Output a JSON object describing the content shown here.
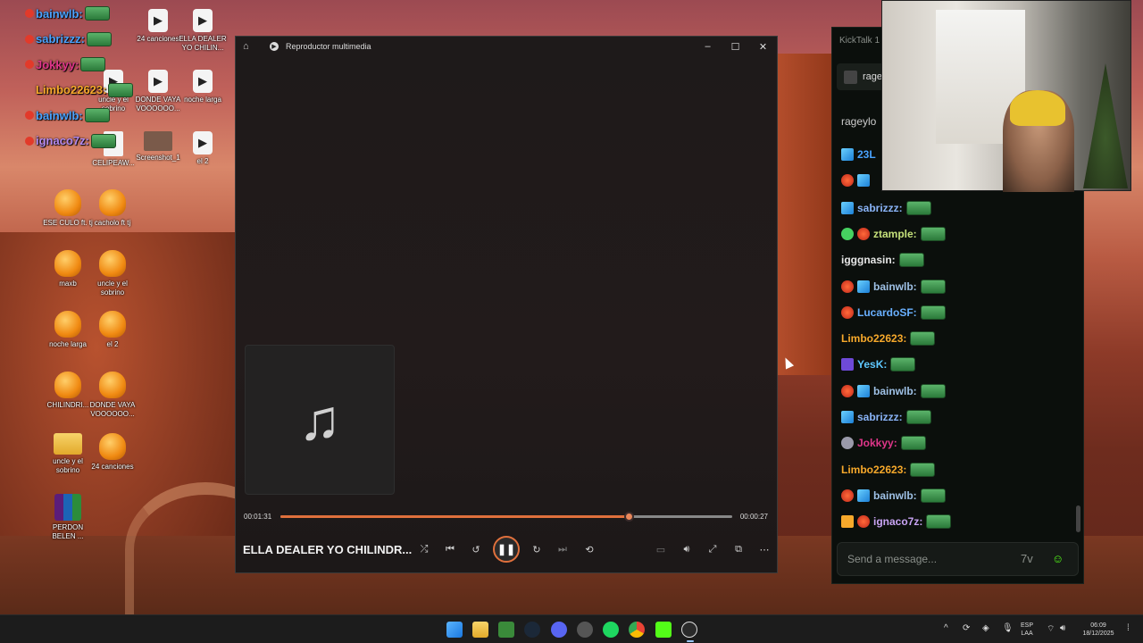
{
  "desktop": {
    "icons": [
      {
        "label": "24 canciones",
        "kind": "media"
      },
      {
        "label": "ELLA DEALER YO CHILIN...",
        "kind": "media"
      },
      {
        "label": "uncle y el sobrino",
        "kind": "media"
      },
      {
        "label": "DONDE VAYA VOOOOOO...",
        "kind": "media"
      },
      {
        "label": "noche larga",
        "kind": "media"
      },
      {
        "label": "CELIPEAW...",
        "kind": "doc"
      },
      {
        "label": "Screenshot_1",
        "kind": "shot"
      },
      {
        "label": "el 2",
        "kind": "media"
      },
      {
        "label": "ESE CULO ft. tj",
        "kind": "fl"
      },
      {
        "label": "cacholo ft tj",
        "kind": "fl"
      },
      {
        "label": "maxb",
        "kind": "fl"
      },
      {
        "label": "uncle y el sobrino",
        "kind": "fl"
      },
      {
        "label": "noche larga",
        "kind": "fl"
      },
      {
        "label": "el 2",
        "kind": "fl"
      },
      {
        "label": "CHILINDRI...",
        "kind": "fl"
      },
      {
        "label": "DONDE VAYA VOOOOOO...",
        "kind": "fl"
      },
      {
        "label": "uncle y el sobrino",
        "kind": "folder"
      },
      {
        "label": "24 canciones",
        "kind": "fl"
      },
      {
        "label": "PERDON BELEN ...",
        "kind": "rar"
      }
    ],
    "overlay_chat": [
      {
        "name": "bainwlb:",
        "color": "#4aa3ff"
      },
      {
        "name": "sabrizzz:",
        "color": "#4aa3ff"
      },
      {
        "name": "Jokkyy:",
        "color": "#e0368a"
      },
      {
        "name": "Limbo22623:",
        "color": "#f7a92b"
      },
      {
        "name": "bainwlb:",
        "color": "#4aa3ff"
      },
      {
        "name": "ignaco7z:",
        "color": "#b38af0"
      }
    ]
  },
  "player": {
    "title": "Reproductor multimedia",
    "song_title": "ELLA DEALER YO CHILINDR...",
    "time_elapsed": "00:01:31",
    "time_remaining": "00:00:27",
    "progress": 0.77,
    "accent": "#e0703c",
    "controls": [
      "shuffle-icon",
      "previous-icon",
      "rewind-icon",
      "pause-icon",
      "forward-icon",
      "next-icon",
      "repeat-icon",
      "miniplayer-icon",
      "volume-icon",
      "fullscreen-icon",
      "cast-icon",
      "more-icon"
    ]
  },
  "kicktalk": {
    "title": "KickTalk 1",
    "tab_label": "ragey",
    "channel": "rageylo",
    "messages": [
      {
        "user": "23L",
        "color": "#4aa3ff",
        "badges": [
          "cube"
        ]
      },
      {
        "user": "",
        "color": "#46d160",
        "badges": [
          "red",
          "cube"
        ]
      },
      {
        "user": "sabrizzz:",
        "color": "#8ab4f8",
        "badges": [
          "cube"
        ]
      },
      {
        "user": "ztample:",
        "color": "#c5e07a",
        "badges": [
          "green",
          "red"
        ]
      },
      {
        "user": "igggnasin:",
        "color": "#e6e6e6",
        "badges": []
      },
      {
        "user": "bainwlb:",
        "color": "#9fc1e6",
        "badges": [
          "red",
          "cube"
        ]
      },
      {
        "user": "LucardoSF:",
        "color": "#69b0ff",
        "badges": [
          "red"
        ]
      },
      {
        "user": "Limbo22623:",
        "color": "#f7a92b",
        "badges": []
      },
      {
        "user": "YesK:",
        "color": "#5ec8ff",
        "badges": [
          "purple"
        ]
      },
      {
        "user": "bainwlb:",
        "color": "#9fc1e6",
        "badges": [
          "red",
          "cube"
        ]
      },
      {
        "user": "sabrizzz:",
        "color": "#8ab4f8",
        "badges": [
          "cube"
        ]
      },
      {
        "user": "Jokkyy:",
        "color": "#e0368a",
        "badges": [
          "gray"
        ]
      },
      {
        "user": "Limbo22623:",
        "color": "#f7a92b",
        "badges": []
      },
      {
        "user": "bainwlb:",
        "color": "#9fc1e6",
        "badges": [
          "red",
          "cube"
        ]
      },
      {
        "user": "ignaco7z:",
        "color": "#c9a4f5",
        "badges": [
          "orange",
          "red"
        ]
      }
    ],
    "input_placeholder": "Send a message..."
  },
  "taskbar": {
    "lang_top": "ESP",
    "lang_bottom": "LAA",
    "time": "06:09",
    "date": "18/12/2025"
  }
}
